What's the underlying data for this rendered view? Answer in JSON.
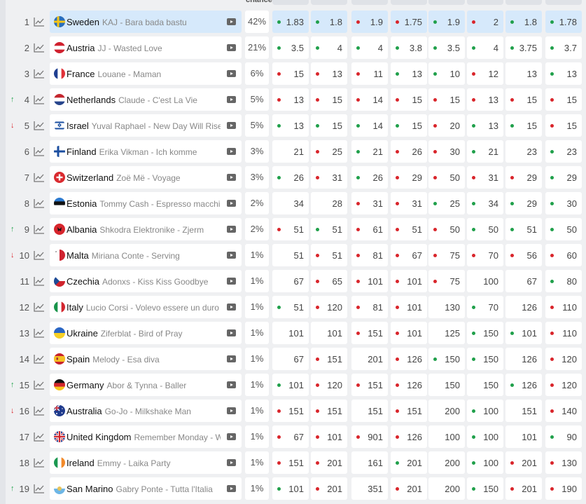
{
  "header": {
    "chance": "chance"
  },
  "colors": {
    "selected_bg": "#d6e9fb",
    "up": "#1fa24a",
    "down": "#d9252b",
    "dot_green": "#20a04b",
    "dot_red": "#d9252b"
  },
  "rows": [
    {
      "rank": "1",
      "country": "Sweden",
      "song": "KAJ - Bara bada bastu",
      "chance": "42%",
      "trend": "",
      "flag": "se",
      "selected": true,
      "odds": [
        {
          "v": "1.83",
          "d": "g"
        },
        {
          "v": "1.8",
          "d": "g"
        },
        {
          "v": "1.9",
          "d": "r"
        },
        {
          "v": "1.75",
          "d": "r"
        },
        {
          "v": "1.9",
          "d": "g"
        },
        {
          "v": "2",
          "d": "r"
        },
        {
          "v": "1.8",
          "d": "g"
        },
        {
          "v": "1.78",
          "d": "g"
        }
      ],
      "best": [
        0,
        1,
        2,
        3,
        4,
        5,
        6,
        7
      ]
    },
    {
      "rank": "2",
      "country": "Austria",
      "song": "JJ - Wasted Love",
      "chance": "21%",
      "trend": "",
      "flag": "at",
      "odds": [
        {
          "v": "3.5",
          "d": "g"
        },
        {
          "v": "4",
          "d": "g"
        },
        {
          "v": "4",
          "d": "g"
        },
        {
          "v": "3.8",
          "d": "g"
        },
        {
          "v": "3.5",
          "d": "g"
        },
        {
          "v": "4",
          "d": "g"
        },
        {
          "v": "3.75",
          "d": "g"
        },
        {
          "v": "3.7",
          "d": "g"
        }
      ]
    },
    {
      "rank": "3",
      "country": "France",
      "song": "Louane - Maman",
      "chance": "6%",
      "trend": "",
      "flag": "fr",
      "odds": [
        {
          "v": "15",
          "d": "r"
        },
        {
          "v": "13",
          "d": "r"
        },
        {
          "v": "11",
          "d": "r"
        },
        {
          "v": "13",
          "d": "g"
        },
        {
          "v": "10",
          "d": "g"
        },
        {
          "v": "12",
          "d": "r"
        },
        {
          "v": "13",
          "d": ""
        },
        {
          "v": "13",
          "d": "g"
        }
      ]
    },
    {
      "rank": "4",
      "country": "Netherlands",
      "song": "Claude - C'est La Vie",
      "chance": "5%",
      "trend": "up",
      "flag": "nl",
      "odds": [
        {
          "v": "13",
          "d": "r"
        },
        {
          "v": "15",
          "d": "r"
        },
        {
          "v": "14",
          "d": "r"
        },
        {
          "v": "15",
          "d": "r"
        },
        {
          "v": "15",
          "d": "r"
        },
        {
          "v": "13",
          "d": "r"
        },
        {
          "v": "15",
          "d": "r"
        },
        {
          "v": "15",
          "d": "r"
        }
      ]
    },
    {
      "rank": "5",
      "country": "Israel",
      "song": "Yuval Raphael - New Day Will Rise",
      "chance": "5%",
      "trend": "down",
      "flag": "il",
      "odds": [
        {
          "v": "13",
          "d": "g"
        },
        {
          "v": "15",
          "d": "g"
        },
        {
          "v": "14",
          "d": "g"
        },
        {
          "v": "15",
          "d": "g"
        },
        {
          "v": "20",
          "d": "r"
        },
        {
          "v": "13",
          "d": "g"
        },
        {
          "v": "15",
          "d": "g"
        },
        {
          "v": "15",
          "d": "r"
        }
      ]
    },
    {
      "rank": "6",
      "country": "Finland",
      "song": "Erika Vikman - Ich komme",
      "chance": "3%",
      "trend": "",
      "flag": "fi",
      "odds": [
        {
          "v": "21",
          "d": ""
        },
        {
          "v": "25",
          "d": "r"
        },
        {
          "v": "21",
          "d": "g"
        },
        {
          "v": "26",
          "d": "r"
        },
        {
          "v": "30",
          "d": "r"
        },
        {
          "v": "21",
          "d": "g"
        },
        {
          "v": "23",
          "d": ""
        },
        {
          "v": "23",
          "d": "g"
        }
      ]
    },
    {
      "rank": "7",
      "country": "Switzerland",
      "song": "Zoë Më - Voyage",
      "chance": "3%",
      "trend": "",
      "flag": "ch",
      "odds": [
        {
          "v": "26",
          "d": "g"
        },
        {
          "v": "31",
          "d": "r"
        },
        {
          "v": "26",
          "d": "g"
        },
        {
          "v": "29",
          "d": "r"
        },
        {
          "v": "50",
          "d": "r"
        },
        {
          "v": "31",
          "d": "r"
        },
        {
          "v": "29",
          "d": "r"
        },
        {
          "v": "29",
          "d": "g"
        }
      ]
    },
    {
      "rank": "8",
      "country": "Estonia",
      "song": "Tommy Cash - Espresso macchiato",
      "chance": "2%",
      "trend": "",
      "flag": "ee",
      "odds": [
        {
          "v": "34",
          "d": ""
        },
        {
          "v": "28",
          "d": ""
        },
        {
          "v": "31",
          "d": "r"
        },
        {
          "v": "31",
          "d": "r"
        },
        {
          "v": "25",
          "d": "g"
        },
        {
          "v": "34",
          "d": "g"
        },
        {
          "v": "29",
          "d": "g"
        },
        {
          "v": "30",
          "d": "g"
        }
      ]
    },
    {
      "rank": "9",
      "country": "Albania",
      "song": "Shkodra Elektronike - Zjerm",
      "chance": "2%",
      "trend": "up",
      "flag": "al",
      "odds": [
        {
          "v": "51",
          "d": "r"
        },
        {
          "v": "51",
          "d": "g"
        },
        {
          "v": "61",
          "d": "r"
        },
        {
          "v": "51",
          "d": "r"
        },
        {
          "v": "50",
          "d": "r"
        },
        {
          "v": "50",
          "d": "g"
        },
        {
          "v": "51",
          "d": "g"
        },
        {
          "v": "50",
          "d": "g"
        }
      ]
    },
    {
      "rank": "10",
      "country": "Malta",
      "song": "Miriana Conte - Serving",
      "chance": "1%",
      "trend": "down",
      "flag": "mt",
      "odds": [
        {
          "v": "51",
          "d": ""
        },
        {
          "v": "51",
          "d": "r"
        },
        {
          "v": "81",
          "d": "r"
        },
        {
          "v": "67",
          "d": "r"
        },
        {
          "v": "75",
          "d": "r"
        },
        {
          "v": "70",
          "d": "r"
        },
        {
          "v": "56",
          "d": "r"
        },
        {
          "v": "60",
          "d": "r"
        }
      ]
    },
    {
      "rank": "11",
      "country": "Czechia",
      "song": "Adonxs - Kiss Kiss Goodbye",
      "chance": "1%",
      "trend": "",
      "flag": "cz",
      "odds": [
        {
          "v": "67",
          "d": ""
        },
        {
          "v": "65",
          "d": "r"
        },
        {
          "v": "101",
          "d": "r"
        },
        {
          "v": "101",
          "d": "r"
        },
        {
          "v": "75",
          "d": "r"
        },
        {
          "v": "100",
          "d": ""
        },
        {
          "v": "67",
          "d": ""
        },
        {
          "v": "80",
          "d": "g"
        }
      ]
    },
    {
      "rank": "12",
      "country": "Italy",
      "song": "Lucio Corsi - Volevo essere un duro",
      "chance": "1%",
      "trend": "",
      "flag": "it",
      "odds": [
        {
          "v": "51",
          "d": "g"
        },
        {
          "v": "120",
          "d": "r"
        },
        {
          "v": "81",
          "d": "r"
        },
        {
          "v": "101",
          "d": "r"
        },
        {
          "v": "130",
          "d": ""
        },
        {
          "v": "70",
          "d": "g"
        },
        {
          "v": "126",
          "d": ""
        },
        {
          "v": "110",
          "d": "r"
        }
      ]
    },
    {
      "rank": "13",
      "country": "Ukraine",
      "song": "Ziferblat - Bird of Pray",
      "chance": "1%",
      "trend": "",
      "flag": "ua",
      "odds": [
        {
          "v": "101",
          "d": ""
        },
        {
          "v": "101",
          "d": ""
        },
        {
          "v": "151",
          "d": "r"
        },
        {
          "v": "101",
          "d": "r"
        },
        {
          "v": "125",
          "d": ""
        },
        {
          "v": "150",
          "d": "g"
        },
        {
          "v": "101",
          "d": "g"
        },
        {
          "v": "110",
          "d": "r"
        }
      ]
    },
    {
      "rank": "14",
      "country": "Spain",
      "song": "Melody - Esa diva",
      "chance": "1%",
      "trend": "",
      "flag": "es",
      "odds": [
        {
          "v": "67",
          "d": ""
        },
        {
          "v": "151",
          "d": "r"
        },
        {
          "v": "201",
          "d": ""
        },
        {
          "v": "126",
          "d": "r"
        },
        {
          "v": "150",
          "d": "g"
        },
        {
          "v": "150",
          "d": "g"
        },
        {
          "v": "126",
          "d": ""
        },
        {
          "v": "120",
          "d": "r"
        }
      ]
    },
    {
      "rank": "15",
      "country": "Germany",
      "song": "Abor & Tynna - Baller",
      "chance": "1%",
      "trend": "up",
      "flag": "de",
      "odds": [
        {
          "v": "101",
          "d": "g"
        },
        {
          "v": "120",
          "d": "r"
        },
        {
          "v": "151",
          "d": "r"
        },
        {
          "v": "126",
          "d": "r"
        },
        {
          "v": "150",
          "d": ""
        },
        {
          "v": "150",
          "d": ""
        },
        {
          "v": "126",
          "d": "g"
        },
        {
          "v": "120",
          "d": "r"
        }
      ]
    },
    {
      "rank": "16",
      "country": "Australia",
      "song": "Go-Jo - Milkshake Man",
      "chance": "1%",
      "trend": "down",
      "flag": "au",
      "odds": [
        {
          "v": "151",
          "d": "r"
        },
        {
          "v": "151",
          "d": "r"
        },
        {
          "v": "151",
          "d": ""
        },
        {
          "v": "151",
          "d": "r"
        },
        {
          "v": "200",
          "d": ""
        },
        {
          "v": "100",
          "d": "g"
        },
        {
          "v": "151",
          "d": ""
        },
        {
          "v": "140",
          "d": "r"
        }
      ]
    },
    {
      "rank": "17",
      "country": "United Kingdom",
      "song": "Remember Monday - Wh…",
      "chance": "1%",
      "trend": "",
      "flag": "gb",
      "odds": [
        {
          "v": "67",
          "d": "r"
        },
        {
          "v": "101",
          "d": "r"
        },
        {
          "v": "901",
          "d": "r"
        },
        {
          "v": "126",
          "d": "r"
        },
        {
          "v": "100",
          "d": ""
        },
        {
          "v": "100",
          "d": "g"
        },
        {
          "v": "101",
          "d": ""
        },
        {
          "v": "90",
          "d": "g"
        }
      ]
    },
    {
      "rank": "18",
      "country": "Ireland",
      "song": "Emmy - Laika Party",
      "chance": "1%",
      "trend": "",
      "flag": "ie",
      "odds": [
        {
          "v": "151",
          "d": "r"
        },
        {
          "v": "201",
          "d": "r"
        },
        {
          "v": "161",
          "d": ""
        },
        {
          "v": "201",
          "d": "g"
        },
        {
          "v": "200",
          "d": ""
        },
        {
          "v": "100",
          "d": "g"
        },
        {
          "v": "201",
          "d": "r"
        },
        {
          "v": "130",
          "d": "r"
        }
      ]
    },
    {
      "rank": "19",
      "country": "San Marino",
      "song": "Gabry Ponte - Tutta l'Italia",
      "chance": "1%",
      "trend": "up",
      "flag": "sm",
      "odds": [
        {
          "v": "101",
          "d": "g"
        },
        {
          "v": "201",
          "d": "r"
        },
        {
          "v": "351",
          "d": ""
        },
        {
          "v": "201",
          "d": "r"
        },
        {
          "v": "200",
          "d": ""
        },
        {
          "v": "150",
          "d": "g"
        },
        {
          "v": "201",
          "d": "r"
        },
        {
          "v": "190",
          "d": "r"
        }
      ]
    }
  ]
}
